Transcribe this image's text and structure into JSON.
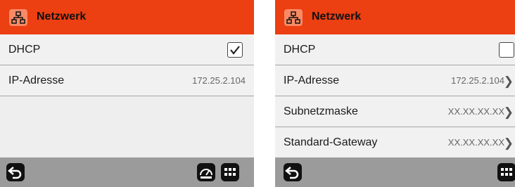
{
  "left": {
    "title": "Netzwerk",
    "dhcp": {
      "label": "DHCP",
      "checked": true
    },
    "ip": {
      "label": "IP-Adresse",
      "value": "172.25.2.104"
    },
    "icons": {
      "back": "back-arrow-icon",
      "speed": "speedometer-icon",
      "grid": "keypad-grid-icon"
    }
  },
  "right": {
    "title": "Netzwerk",
    "dhcp": {
      "label": "DHCP",
      "checked": false
    },
    "ip": {
      "label": "IP-Adresse",
      "value": "172.25.2.104"
    },
    "subnet": {
      "label": "Subnetzmaske",
      "value": "XX.XX.XX.XX"
    },
    "gateway": {
      "label": "Standard-Gateway",
      "value": "XX.XX.XX.XX"
    },
    "icons": {
      "back": "back-arrow-icon",
      "grid": "keypad-grid-icon"
    }
  },
  "colors": {
    "header": "#ec3f12",
    "header_icon": "#f98a66",
    "footer": "#9b9b9b"
  }
}
